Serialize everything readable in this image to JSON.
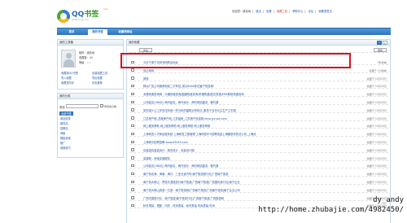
{
  "logo": {
    "main_a": "QQ",
    "main_b": "书签",
    "sub": "shuqian.qq.com",
    "beta": "beta"
  },
  "toplinks": [
    "欢迎您：绿色地",
    "|",
    "退出",
    "|",
    "设置",
    "|",
    "收藏工具",
    "|",
    "帮助中心",
    "|",
    "论坛",
    "|",
    "我要提意见"
  ],
  "nav": {
    "tabs": [
      "首页",
      "我的书签",
      "收藏夹网址"
    ]
  },
  "tools": {
    "header": "我的工具箱",
    "user_lines": [
      "昵称：绿色地",
      "收藏数：43",
      "等级：☆☆"
    ],
    "links": [
      "收藏到QQ书签",
      "安装收藏工具",
      "导入收藏",
      "导出收藏",
      "收藏夹同步",
      "好友推荐"
    ]
  },
  "cats": {
    "header": "我的分类",
    "search_label": "查找",
    "search_option": "所有的分类",
    "add_label": "添加",
    "items": [
      "全部书签",
      "网站收录",
      "国内站",
      "招聘站",
      "博客",
      "模板资源",
      "推广",
      "营销技巧"
    ]
  },
  "main": {
    "header": "我的收藏",
    "pages": [
      "1",
      "▸"
    ],
    "toolbar": [
      "移动",
      "删除"
    ],
    "rows": [
      {
        "title": "今天千零千手机号码购买地址",
        "meta": "9秒钟前"
      },
      {
        "title": "信达家政",
        "meta": "收藏于 1分钟前"
      },
      {
        "title": "搞笑",
        "meta": "收藏于 10月10日"
      },
      {
        "title": "株洲广告公司推荐到前二字号站_成功5000多位客户的选择！",
        "meta": "收藏于 10月10日"
      },
      {
        "title": "永顺快递查询网 - 中通快递查询|圆通快递查询|申通快递|韵达快递|EMS邮政快递查询",
        "meta": "收藏于 10月10日"
      },
      {
        "title": "公司起名(380元) 两刊起名、两刊设计、两刊网站建设 - 雅刊源",
        "meta": "收藏于 10月10日"
      },
      {
        "title": "如何减少让工作负压利用一些分析的建筑业有效法_服务于当代为主生产之中国",
        "meta": "收藏于 10月10日"
      },
      {
        "title": "江苏房产网_苏港房产网_江苏租房_江苏房产信息网-fang.jyyuan.com",
        "meta": "收藏于 10月10日"
      },
      {
        "title": "网上服务帮助 网上服务帮助 网上服务帮助 网上服务帮助",
        "meta": "收藏于 10月10日"
      },
      {
        "title": "上海研发人才和经营系统 上海研发工程管理 上海研发KTV招聘信息上海都是你的总公司_上海优",
        "meta": "收藏于 10月10日"
      },
      {
        "title": "上海家乐招聘招聘 www.05019.com",
        "meta": "收藏于 10月10日"
      },
      {
        "title": "包装盒包装盒设计 - 网页设计 - 包装设计图",
        "meta": "收藏于 10月10日"
      },
      {
        "title": "高端网 - 淘宝店铺靓站",
        "meta": "收藏于 10月10日"
      },
      {
        "title": "公司起名(380元) 两刊起名、两刊设计、两刊网站建设 - 雅刊源",
        "meta": "收藏于 10月10日"
      },
      {
        "title": "南宁到北海、海南、海口、三亚长途汽车|南宁旅游旅行社|广西南宁旅游",
        "meta": "收藏于 10月10日"
      },
      {
        "title": "南宁到大明山 - 梦游天涯旅游行南宁旅游|广西南宁旅游|广西国际旅行社|南宁企业",
        "meta": "收藏于 10月10日"
      },
      {
        "title": "南宁到大明山旅游一日游 - 南宁旅游网|广西南宁旅游|广西南宁旅游|南宁企业公司",
        "meta": "收藏于 10月10日"
      },
      {
        "title": "广西中国旅行社 - 南宁旅游|南宁旅游行社|广西南宁旅游|广西旅游网",
        "meta": "收藏于 10月10日"
      },
      {
        "title": "秋冬男装 - 搭配 - 内衣 - 时尚男装 - 秋冬男装 时尚男装 时尚",
        "meta": "收藏于 10月10日"
      }
    ]
  },
  "watermark": {
    "line1": "dy_andy",
    "line2": "http://home.zhubajie.com/4982450/"
  },
  "colors": {
    "brand_blue": "#2f73bb",
    "highlight_red": "#d1141f"
  }
}
